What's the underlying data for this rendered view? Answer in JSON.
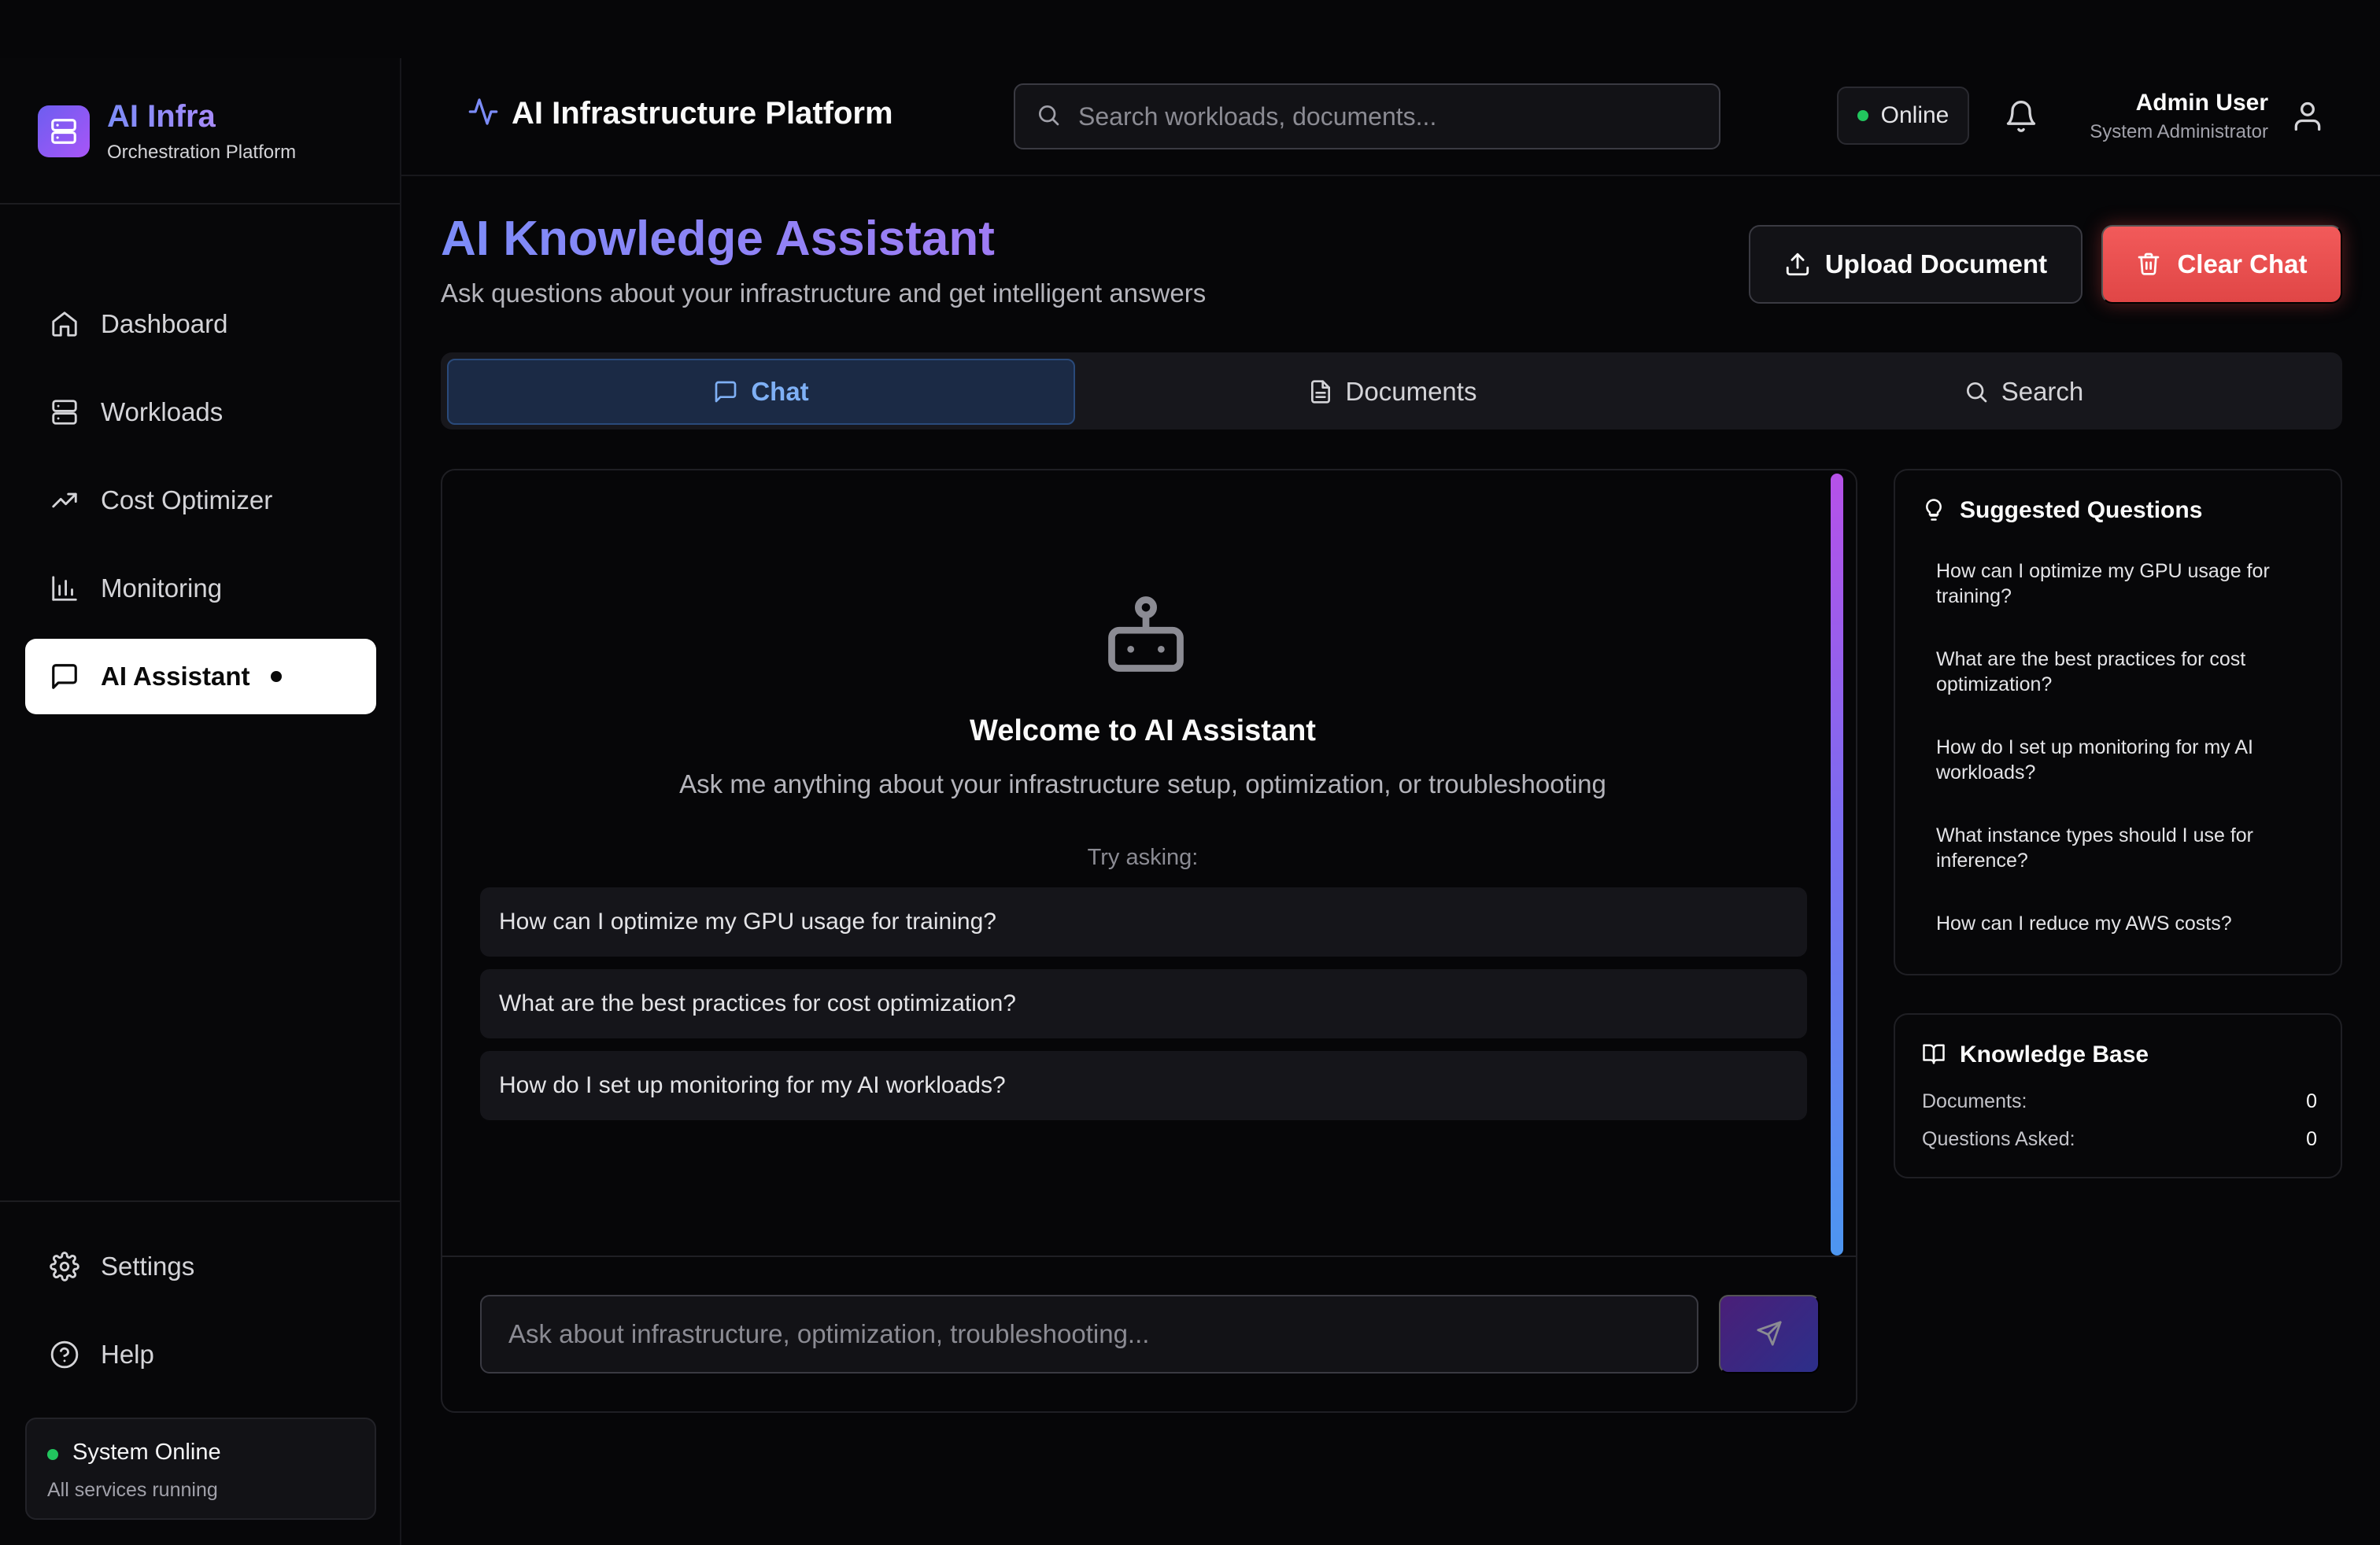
{
  "brand": {
    "title": "AI Infra",
    "subtitle": "Orchestration Platform"
  },
  "nav": {
    "items": [
      {
        "label": "Dashboard",
        "icon": "home-icon"
      },
      {
        "label": "Workloads",
        "icon": "server-icon"
      },
      {
        "label": "Cost Optimizer",
        "icon": "trending-up-icon"
      },
      {
        "label": "Monitoring",
        "icon": "bar-chart-icon"
      },
      {
        "label": "AI Assistant",
        "icon": "message-square-icon",
        "active": true
      }
    ],
    "bottom": [
      {
        "label": "Settings",
        "icon": "gear-icon"
      },
      {
        "label": "Help",
        "icon": "help-circle-icon"
      }
    ]
  },
  "system_status": {
    "title": "System Online",
    "subtitle": "All services running",
    "color": "#22c55e"
  },
  "header": {
    "title": "AI Infrastructure Platform",
    "search_placeholder": "Search workloads, documents...",
    "status": "Online",
    "user_name": "Admin User",
    "user_role": "System Administrator"
  },
  "page": {
    "title": "AI Knowledge Assistant",
    "subtitle": "Ask questions about your infrastructure and get intelligent answers",
    "upload_label": "Upload Document",
    "clear_label": "Clear Chat"
  },
  "tabs": [
    {
      "label": "Chat",
      "icon": "message-square-icon",
      "active": true
    },
    {
      "label": "Documents",
      "icon": "file-text-icon"
    },
    {
      "label": "Search",
      "icon": "search-icon"
    }
  ],
  "chat": {
    "welcome_title": "Welcome to AI Assistant",
    "welcome_subtitle": "Ask me anything about your infrastructure setup, optimization, or troubleshooting",
    "try_label": "Try asking:",
    "suggestions": [
      "How can I optimize my GPU usage for training?",
      "What are the best practices for cost optimization?",
      "How do I set up monitoring for my AI workloads?"
    ],
    "input_placeholder": "Ask about infrastructure, optimization, troubleshooting..."
  },
  "suggested_questions": {
    "title": "Suggested Questions",
    "items": [
      "How can I optimize my GPU usage for training?",
      "What are the best practices for cost optimization?",
      "How do I set up monitoring for my AI workloads?",
      "What instance types should I use for inference?",
      "How can I reduce my AWS costs?"
    ]
  },
  "knowledge_base": {
    "title": "Knowledge Base",
    "documents_label": "Documents:",
    "documents_value": "0",
    "questions_label": "Questions Asked:",
    "questions_value": "0"
  },
  "colors": {
    "accent": "#7c8cf8",
    "danger": "#ef4444",
    "online": "#22c55e",
    "active_tab_text": "#7fb0f5"
  }
}
